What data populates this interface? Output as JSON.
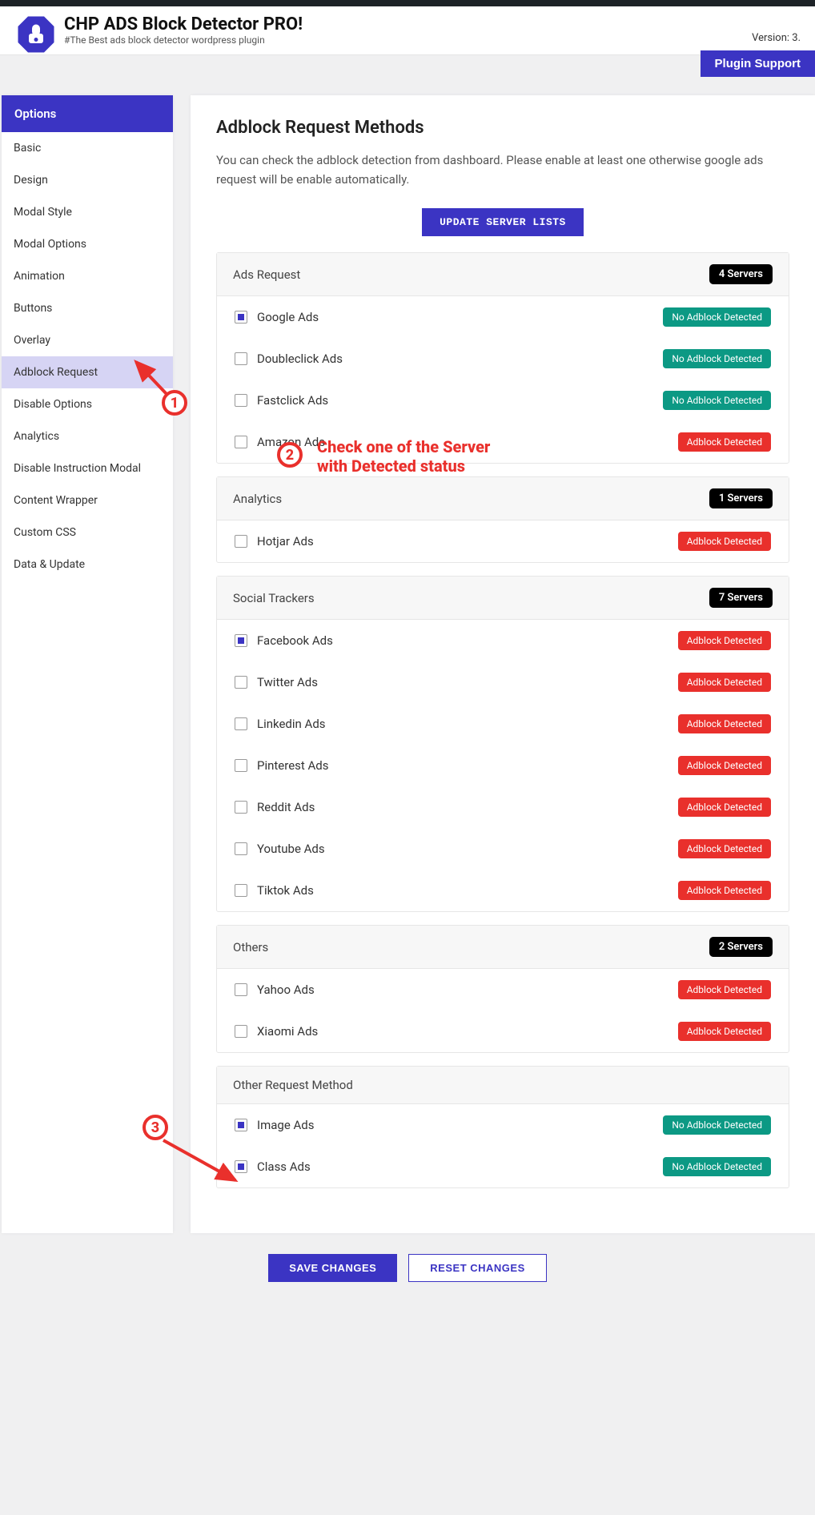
{
  "header": {
    "title": "CHP ADS Block Detector PRO!",
    "subtitle": "#The Best ads block detector wordpress plugin",
    "version": "Version: 3.",
    "support": "Plugin Support"
  },
  "sidebar": {
    "title": "Options",
    "items": [
      "Basic",
      "Design",
      "Modal Style",
      "Modal Options",
      "Animation",
      "Buttons",
      "Overlay",
      "Adblock Request",
      "Disable Options",
      "Analytics",
      "Disable Instruction Modal",
      "Content Wrapper",
      "Custom CSS",
      "Data & Update"
    ],
    "activeIndex": 7
  },
  "page": {
    "title": "Adblock Request Methods",
    "desc": "You can check the adblock detection from dashboard. Please enable at least one otherwise google ads request will be enable automatically.",
    "updateBtn": "UPDATE SERVER LISTS",
    "serversWord": "Servers",
    "status": {
      "ok": "No Adblock Detected",
      "det": "Adblock Detected"
    },
    "groups": [
      {
        "title": "Ads Request",
        "count": 4,
        "items": [
          {
            "label": "Google Ads",
            "checked": true,
            "status": "ok"
          },
          {
            "label": "Doubleclick Ads",
            "checked": false,
            "status": "ok"
          },
          {
            "label": "Fastclick Ads",
            "checked": false,
            "status": "ok"
          },
          {
            "label": "Amazon Ads",
            "checked": false,
            "status": "det"
          }
        ]
      },
      {
        "title": "Analytics",
        "count": 1,
        "items": [
          {
            "label": "Hotjar Ads",
            "checked": false,
            "status": "det"
          }
        ]
      },
      {
        "title": "Social Trackers",
        "count": 7,
        "items": [
          {
            "label": "Facebook Ads",
            "checked": true,
            "status": "det"
          },
          {
            "label": "Twitter Ads",
            "checked": false,
            "status": "det"
          },
          {
            "label": "Linkedin Ads",
            "checked": false,
            "status": "det"
          },
          {
            "label": "Pinterest Ads",
            "checked": false,
            "status": "det"
          },
          {
            "label": "Reddit Ads",
            "checked": false,
            "status": "det"
          },
          {
            "label": "Youtube Ads",
            "checked": false,
            "status": "det"
          },
          {
            "label": "Tiktok Ads",
            "checked": false,
            "status": "det"
          }
        ]
      },
      {
        "title": "Others",
        "count": 2,
        "items": [
          {
            "label": "Yahoo Ads",
            "checked": false,
            "status": "det"
          },
          {
            "label": "Xiaomi Ads",
            "checked": false,
            "status": "det"
          }
        ]
      },
      {
        "title": "Other Request Method",
        "count": null,
        "items": [
          {
            "label": "Image Ads",
            "checked": true,
            "status": "ok"
          },
          {
            "label": "Class Ads",
            "checked": true,
            "status": "ok"
          }
        ]
      }
    ]
  },
  "actions": {
    "save": "SAVE CHANGES",
    "reset": "RESET CHANGES"
  },
  "annotations": {
    "n1": "1",
    "n2": "2",
    "n3": "3",
    "text2a": "Check one of the Server",
    "text2b": "with Detected status"
  }
}
